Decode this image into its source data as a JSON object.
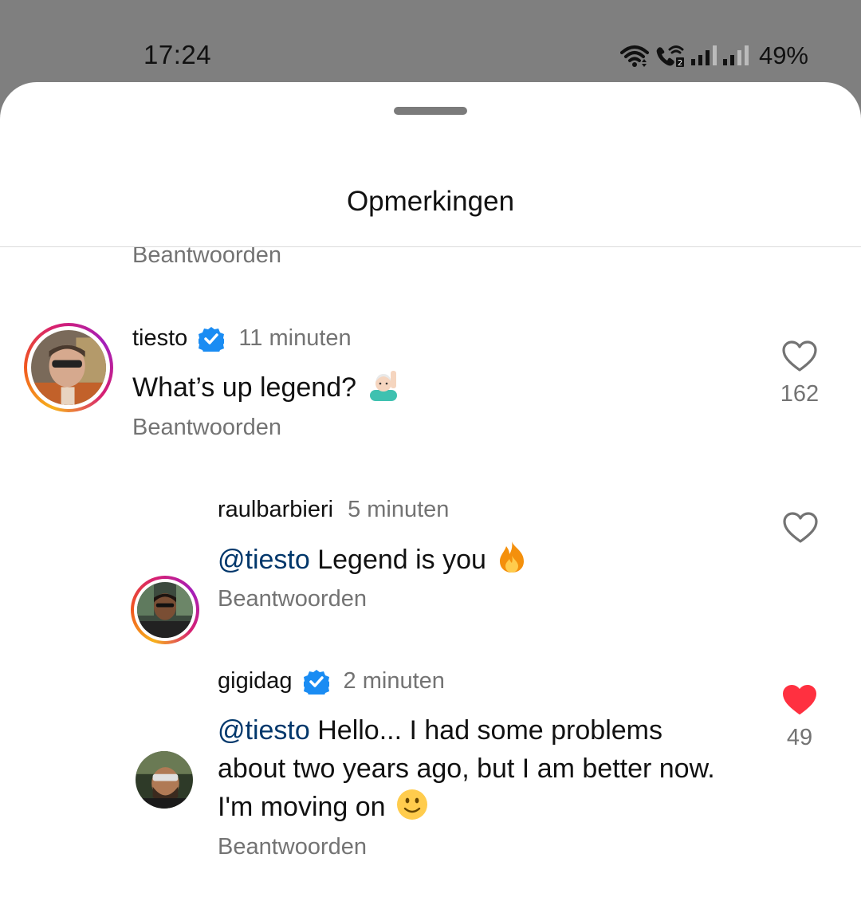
{
  "status_bar": {
    "time": "17:24",
    "battery": "49%",
    "icons": [
      "wifi-icon",
      "wifi-call-icon",
      "signal-icon",
      "signal-icon"
    ]
  },
  "sheet": {
    "title": "Opmerkingen"
  },
  "previous_reply_label": "Beantwoorden",
  "comments": [
    {
      "username": "tiesto",
      "verified": true,
      "time_ago": "11 minuten",
      "text": "What’s up legend?",
      "emoji": "raising-hand-emoji",
      "reply_label": "Beantwoorden",
      "like_count": "162",
      "liked": false
    },
    {
      "username": "raulbarbieri",
      "verified": false,
      "time_ago": "5 minuten",
      "mention": "@tiesto",
      "text": " Legend is you",
      "emoji": "fire-emoji",
      "reply_label": "Beantwoorden",
      "liked": false
    },
    {
      "username": "gigidag",
      "verified": true,
      "time_ago": "2 minuten",
      "mention": "@tiesto",
      "text_line1": " Hello... I had some problems",
      "text_line2": "about two years ago, but I am better now.",
      "text_line3": "I'm moving on",
      "emoji": "slightly-smiling-emoji",
      "reply_label": "Beantwoorden",
      "like_count": "49",
      "liked": true
    }
  ],
  "colors": {
    "mention": "#00376b",
    "verified": "#1a8cf3",
    "liked_heart": "#ff3040",
    "secondary_text": "#737373"
  }
}
